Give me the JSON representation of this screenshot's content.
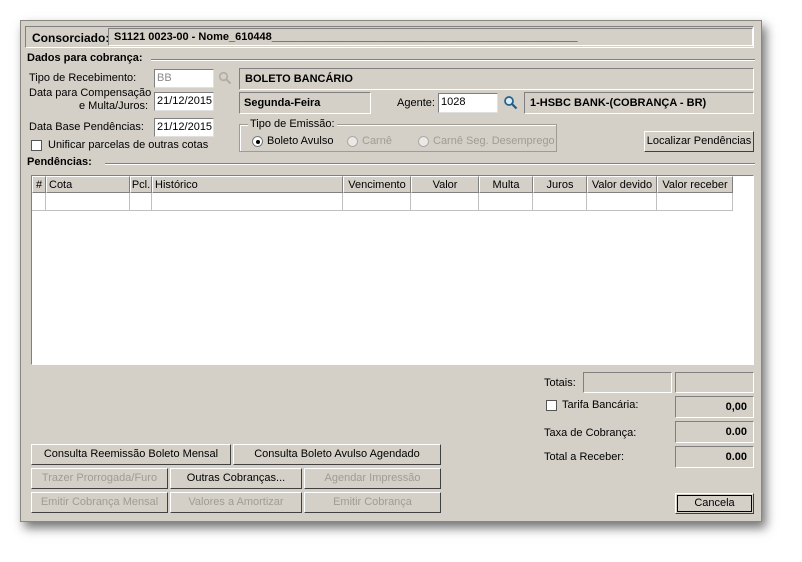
{
  "consorciado": {
    "label": "Consorciado:",
    "value": "S1121  0023-00 - Nome_610448__________________________________________________"
  },
  "dados": {
    "title": "Dados para cobrança:",
    "tipo_recebimento_label": "Tipo de Recebimento:",
    "tipo_recebimento_value": "BB",
    "tipo_recebimento_desc": "BOLETO BANCÁRIO",
    "data_comp_label_1": "Data para Compensação",
    "data_comp_label_2": "e Multa/Juros:",
    "data_comp_value": "21/12/2015",
    "dia_semana": "Segunda-Feira",
    "agente_label": "Agente:",
    "agente_value": "1028",
    "agente_desc": "1-HSBC BANK-(COBRANÇA - BR)",
    "data_base_label": "Data Base Pendências:",
    "data_base_value": "21/12/2015",
    "unificar_label": "Unificar parcelas de outras cotas",
    "tipo_emissao_label": "Tipo de Emissão:",
    "emissao_options": [
      "Boleto Avulso",
      "Carnê",
      "Carnê Seg. Desemprego"
    ],
    "localizar_button": "Localizar Pendências"
  },
  "pendencias": {
    "title": "Pendências:",
    "columns": [
      "#",
      "Cota",
      "Pcl.",
      "Histórico",
      "Vencimento",
      "Valor",
      "Multa",
      "Juros",
      "Valor devido",
      "Valor receber"
    ]
  },
  "totais": {
    "totais_label": "Totais:",
    "tarifa_label": "Tarifa Bancária:",
    "tarifa_value": "0,00",
    "taxa_label": "Taxa de Cobrança:",
    "taxa_value": "0.00",
    "total_label": "Total a Receber:",
    "total_value": "0.00"
  },
  "buttons": {
    "consulta_reemissao": "Consulta Reemissão Boleto Mensal",
    "consulta_avulso": "Consulta Boleto Avulso Agendado",
    "trazer_prorrogada": "Trazer Prorrogada/Furo",
    "outras_cobrancas": "Outras Cobranças...",
    "agendar_impressao": "Agendar Impressão",
    "emitir_mensal": "Emitir Cobrança Mensal",
    "valores_amortizar": "Valores a Amortizar",
    "emitir_cobranca": "Emitir Cobrança",
    "cancela": "Cancela"
  }
}
